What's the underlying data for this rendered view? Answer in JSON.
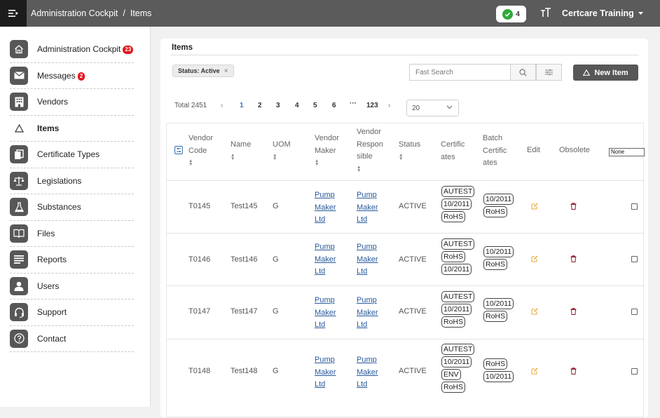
{
  "header": {
    "breadcrumb_root": "Administration Cockpit",
    "breadcrumb_sep": "/",
    "breadcrumb_current": "Items",
    "status_count": "4",
    "account_name": "Certcare Training"
  },
  "sidebar": {
    "items": [
      {
        "label": "Administration Cockpit",
        "badge": "23"
      },
      {
        "label": "Messages",
        "badge": "2"
      },
      {
        "label": "Vendors",
        "badge": ""
      },
      {
        "label": "Items",
        "badge": ""
      },
      {
        "label": "Certificate Types",
        "badge": ""
      },
      {
        "label": "Legislations",
        "badge": ""
      },
      {
        "label": "Substances",
        "badge": ""
      },
      {
        "label": "Files",
        "badge": ""
      },
      {
        "label": "Reports",
        "badge": ""
      },
      {
        "label": "Users",
        "badge": ""
      },
      {
        "label": "Support",
        "badge": ""
      },
      {
        "label": "Contact",
        "badge": ""
      }
    ]
  },
  "panel": {
    "title": "Items",
    "filter_chip": "Status: Active",
    "filter_chip_close": "×",
    "search_placeholder": "Fast Search",
    "new_item_label": "New Item"
  },
  "pager": {
    "total": "Total 2451",
    "prev": "‹",
    "next": "›",
    "pages": [
      "1",
      "2",
      "3",
      "4",
      "5",
      "6",
      "···",
      "123"
    ],
    "active_page": "1",
    "page_size": "20"
  },
  "table": {
    "headers": {
      "vendor_code": [
        "Vendor",
        "Code"
      ],
      "name": "Name",
      "uom": "UOM",
      "vendor_maker": [
        "Vendor",
        "Maker"
      ],
      "vendor_responsible": [
        "Vendor",
        "Respon",
        "sible"
      ],
      "status": "Status",
      "certificates": [
        "Certific",
        "ates"
      ],
      "batch_certificates": [
        "Batch",
        "Certific",
        "ates"
      ],
      "edit": "Edit",
      "obsolete": "Obsolete"
    },
    "obsolete_filter": "None",
    "rows": [
      {
        "code": "T0145",
        "name": "Test145",
        "uom": "G",
        "maker": [
          "Pump",
          "Maker",
          "Ltd"
        ],
        "responsible": [
          "Pump",
          "Maker",
          "Ltd"
        ],
        "status": "ACTIVE",
        "certificates": [
          "AUTEST",
          "10/2011",
          "RoHS"
        ],
        "batch": [
          "10/2011",
          "RoHS"
        ]
      },
      {
        "code": "T0146",
        "name": "Test146",
        "uom": "G",
        "maker": [
          "Pump",
          "Maker",
          "Ltd"
        ],
        "responsible": [
          "Pump",
          "Maker",
          "Ltd"
        ],
        "status": "ACTIVE",
        "certificates": [
          "AUTEST",
          "RoHS",
          "10/2011"
        ],
        "batch": [
          "10/2011",
          "RoHS"
        ]
      },
      {
        "code": "T0147",
        "name": "Test147",
        "uom": "G",
        "maker": [
          "Pump",
          "Maker",
          "Ltd"
        ],
        "responsible": [
          "Pump",
          "Maker",
          "Ltd"
        ],
        "status": "ACTIVE",
        "certificates": [
          "AUTEST",
          "10/2011",
          "RoHS"
        ],
        "batch": [
          "10/2011",
          "RoHS"
        ]
      },
      {
        "code": "T0148",
        "name": "Test148",
        "uom": "G",
        "maker": [
          "Pump",
          "Maker",
          "Ltd"
        ],
        "responsible": [
          "Pump",
          "Maker",
          "Ltd"
        ],
        "status": "ACTIVE",
        "certificates": [
          "AUTEST",
          "10/2011",
          "ENV",
          "RoHS"
        ],
        "batch": [
          "RoHS",
          "10/2011"
        ]
      }
    ]
  },
  "colors": {
    "topbar": "#5b5b5b",
    "menu_button": "#1c1c1c",
    "badge": "#e3141b",
    "link": "#2a5a9c",
    "edit_icon": "#e8a532",
    "delete_icon": "#8b1a2b",
    "status_ok": "#2eaa3a"
  },
  "icons": {
    "menu": "menu-toggle-icon",
    "status": "check-circle-icon",
    "font_size": "text-size-icon",
    "account": "caret-down-icon",
    "search": "search-icon",
    "filter": "sliders-icon",
    "new_item": "triangle-icon",
    "edit": "edit-icon",
    "delete": "trash-icon"
  }
}
